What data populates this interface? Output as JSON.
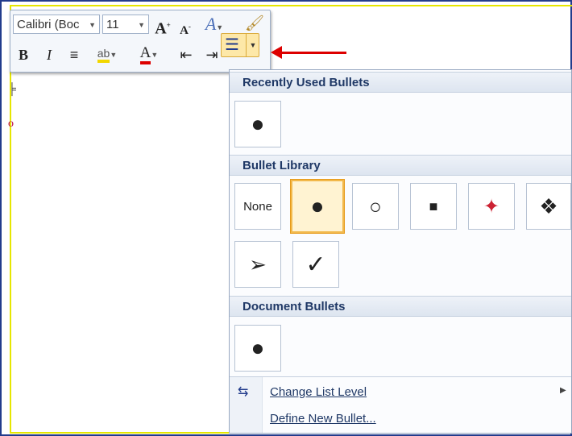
{
  "toolbar": {
    "font_name": "Calibri (Boc",
    "font_size": "11"
  },
  "gallery": {
    "sections": {
      "recent": "Recently Used Bullets",
      "library": "Bullet Library",
      "document": "Document Bullets"
    },
    "library_items": [
      "None",
      "filled-circle",
      "hollow-circle",
      "filled-square",
      "colored-star",
      "four-diamonds",
      "arrowhead",
      "checkmark"
    ],
    "menu": {
      "change_level": "Change List Level",
      "define_new": "Define New Bullet..."
    }
  },
  "colors": {
    "accent_red": "#dd0000",
    "highlight_yellow": "#f2d700",
    "selection_orange": "#f2b84b"
  }
}
